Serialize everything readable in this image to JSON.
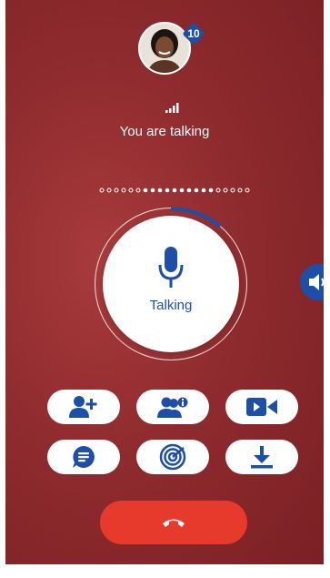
{
  "call": {
    "badge_count": "10",
    "status_text": "You are talking",
    "talk_label": "Talking"
  },
  "icons": {
    "avatar": "contact-avatar",
    "signal": "signal-strength-icon",
    "microphone": "microphone-icon",
    "speaker": "speaker-icon",
    "add_participant": "add-user-icon",
    "participants_info": "participants-info-icon",
    "video": "video-camera-icon",
    "chat": "chat-icon",
    "radar": "radar-icon",
    "download": "download-icon",
    "end_call": "hang-up-icon"
  },
  "colors": {
    "background": "#8e2b2e",
    "accent": "#1e4fa6",
    "end_call": "#e63a2c",
    "button_bg": "#ffffff"
  }
}
